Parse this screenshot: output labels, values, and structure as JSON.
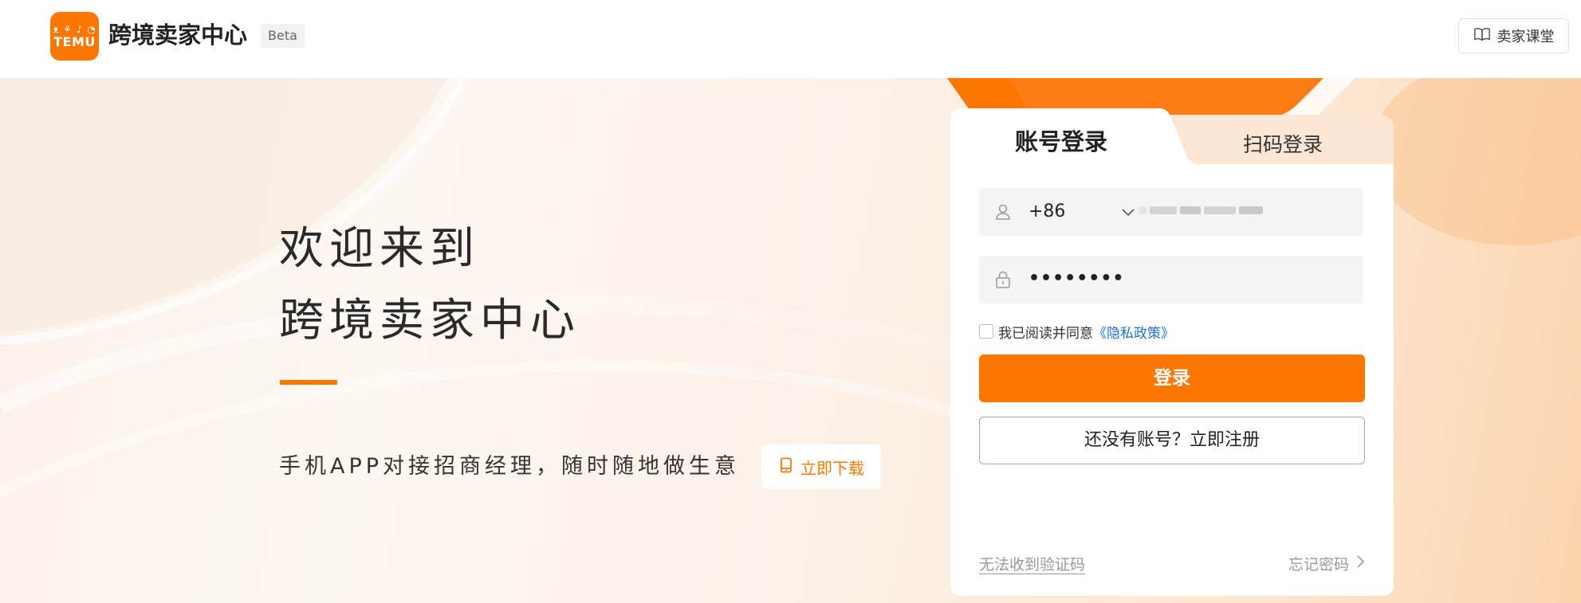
{
  "header": {
    "logo_glyphs": "ᴥ ⚘ ♪ ◔",
    "logo_word": "TEMU",
    "title": "跨境卖家中心",
    "beta": "Beta",
    "course_label": "卖家课堂"
  },
  "hero": {
    "welcome_line1": "欢迎来到",
    "welcome_line2": "跨境卖家中心",
    "tagline": "手机APP对接招商经理，随时随地做生意",
    "download_label": "立即下载"
  },
  "login": {
    "tab_account": "账号登录",
    "tab_qr": "扫码登录",
    "country_code": "+86",
    "password_mask": "••••••••",
    "agree_text": "我已阅读并同意",
    "privacy_link": "《隐私政策》",
    "login_button": "登录",
    "register_button": "还没有账号？立即注册",
    "no_code_link": "无法收到验证码",
    "forgot_link": "忘记密码"
  },
  "colors": {
    "brand": "#fb7701",
    "link": "#1e6fd9"
  },
  "icons": [
    "user-icon",
    "lock-icon",
    "chevron-down-icon",
    "book-icon",
    "phone-icon",
    "chevron-right-icon"
  ]
}
